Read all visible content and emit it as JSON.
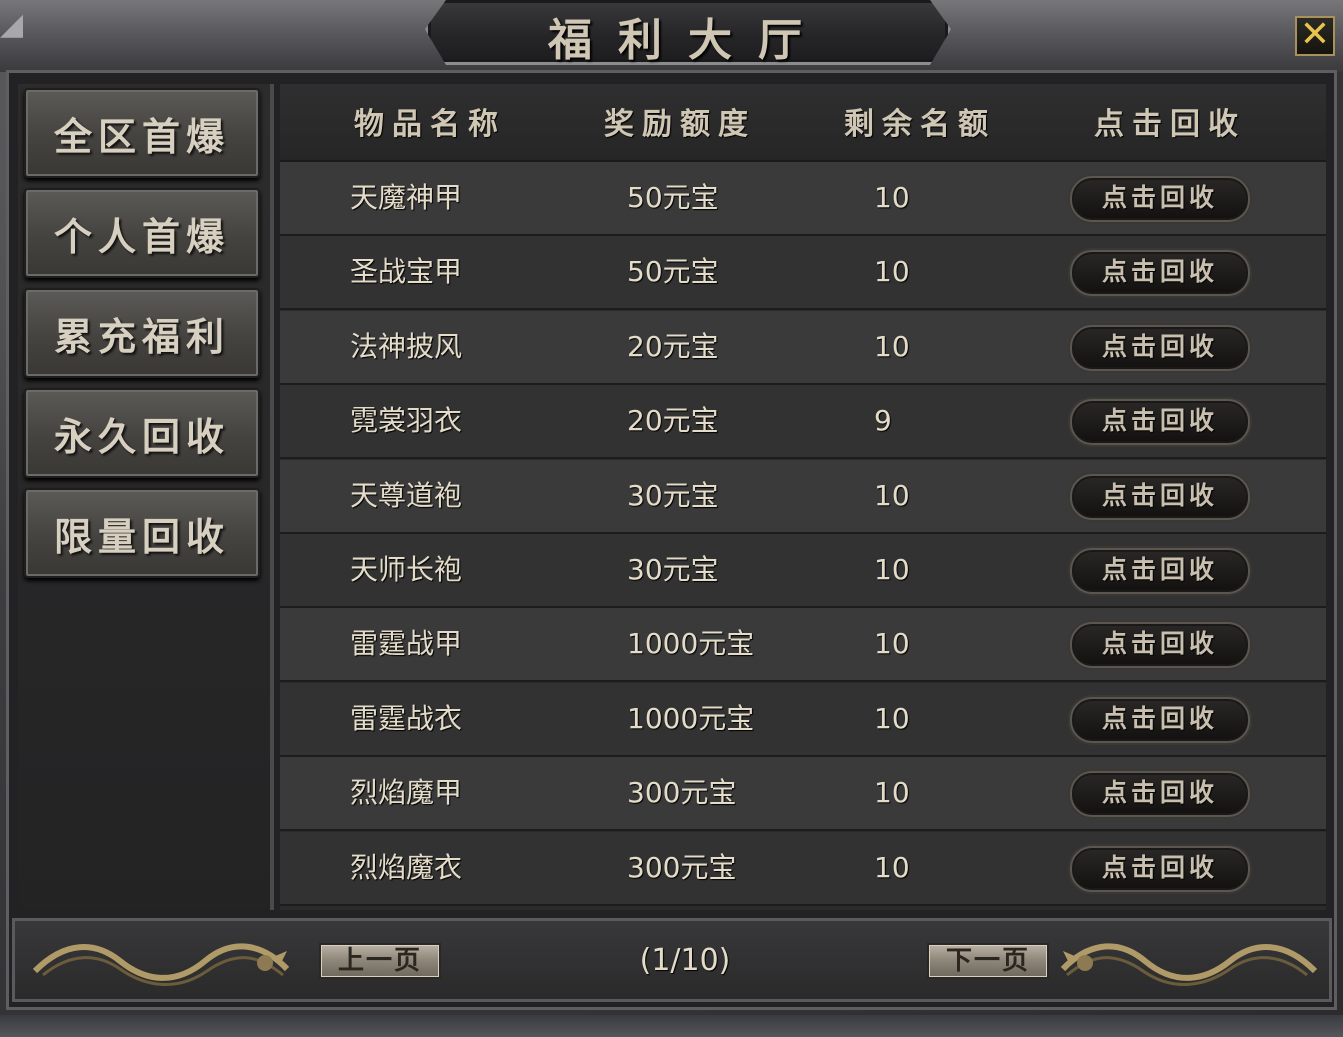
{
  "window": {
    "title": "福利大厅",
    "close_symbol": "✕"
  },
  "sidebar": {
    "items": [
      {
        "label": "全区首爆"
      },
      {
        "label": "个人首爆"
      },
      {
        "label": "累充福利"
      },
      {
        "label": "永久回收"
      },
      {
        "label": "限量回收"
      }
    ]
  },
  "table": {
    "headers": [
      "物品名称",
      "奖励额度",
      "剩余名额",
      "点击回收"
    ],
    "rows": [
      {
        "name": "天魔神甲",
        "reward": "50元宝",
        "remaining": "10",
        "action": "点击回收"
      },
      {
        "name": "圣战宝甲",
        "reward": "50元宝",
        "remaining": "10",
        "action": "点击回收"
      },
      {
        "name": "法神披风",
        "reward": "20元宝",
        "remaining": "10",
        "action": "点击回收"
      },
      {
        "name": "霓裳羽衣",
        "reward": "20元宝",
        "remaining": "9",
        "action": "点击回收"
      },
      {
        "name": "天尊道袍",
        "reward": "30元宝",
        "remaining": "10",
        "action": "点击回收"
      },
      {
        "name": "天师长袍",
        "reward": "30元宝",
        "remaining": "10",
        "action": "点击回收"
      },
      {
        "name": "雷霆战甲",
        "reward": "1000元宝",
        "remaining": "10",
        "action": "点击回收"
      },
      {
        "name": "雷霆战衣",
        "reward": "1000元宝",
        "remaining": "10",
        "action": "点击回收"
      },
      {
        "name": "烈焰魔甲",
        "reward": "300元宝",
        "remaining": "10",
        "action": "点击回收"
      },
      {
        "name": "烈焰魔衣",
        "reward": "300元宝",
        "remaining": "10",
        "action": "点击回收"
      }
    ]
  },
  "pagination": {
    "prev_label": "上一页",
    "next_label": "下一页",
    "indicator": "(1/10)"
  },
  "colors": {
    "title_text": "#cfc6b4",
    "close_accent": "#e8c44d",
    "row_odd": "#3a3a3b",
    "row_even": "#323233"
  }
}
